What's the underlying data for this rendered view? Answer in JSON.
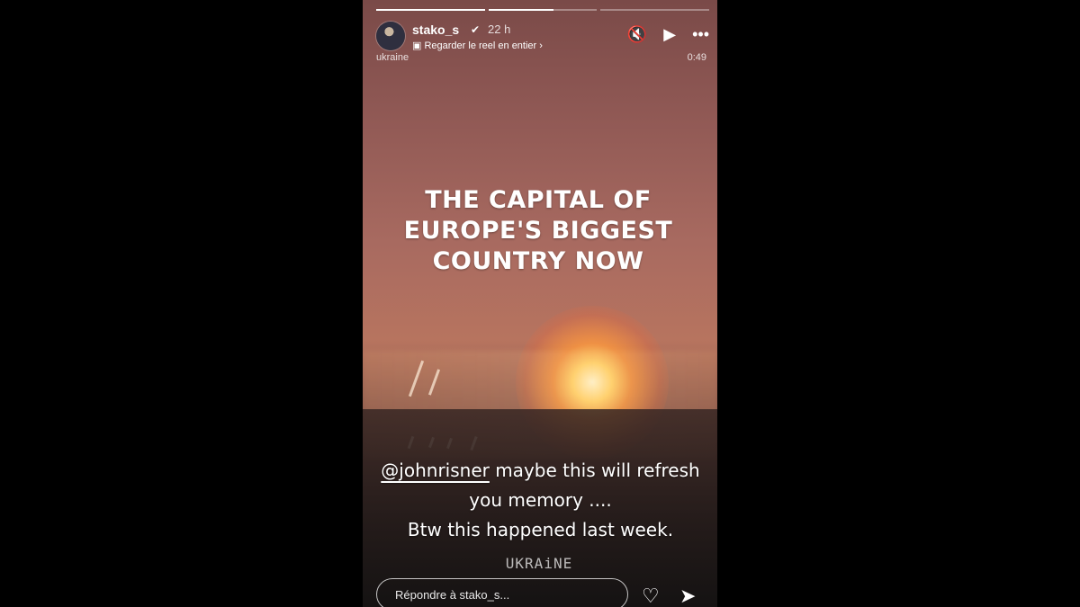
{
  "story": {
    "username": "stako_s",
    "verified_icon": "check-badge-icon",
    "time": "22 h",
    "reel_link_icon": "reel-icon",
    "reel_link_label": "Regarder le reel en entier",
    "location": "ukraine",
    "duration": "0:49",
    "headline": [
      "THE CAPITAL OF",
      "EUROPE'S BIGGEST",
      "COUNTRY NOW"
    ],
    "caption": {
      "mention": "@johnrisner",
      "line1_rest": "maybe this will refresh",
      "line2": "you memory ....",
      "line3": "Btw this happened last week."
    },
    "watermark": "UKRAiNE",
    "reply_placeholder": "Répondre à stako_s...",
    "controls": {
      "mute_icon": "speaker-muted-icon",
      "play_icon": "play-icon",
      "more_icon": "more-horizontal-icon",
      "like_icon": "heart-icon",
      "send_icon": "send-icon"
    },
    "progress_segments": 3,
    "progress_current": 2,
    "progress_current_fraction": 0.6
  }
}
